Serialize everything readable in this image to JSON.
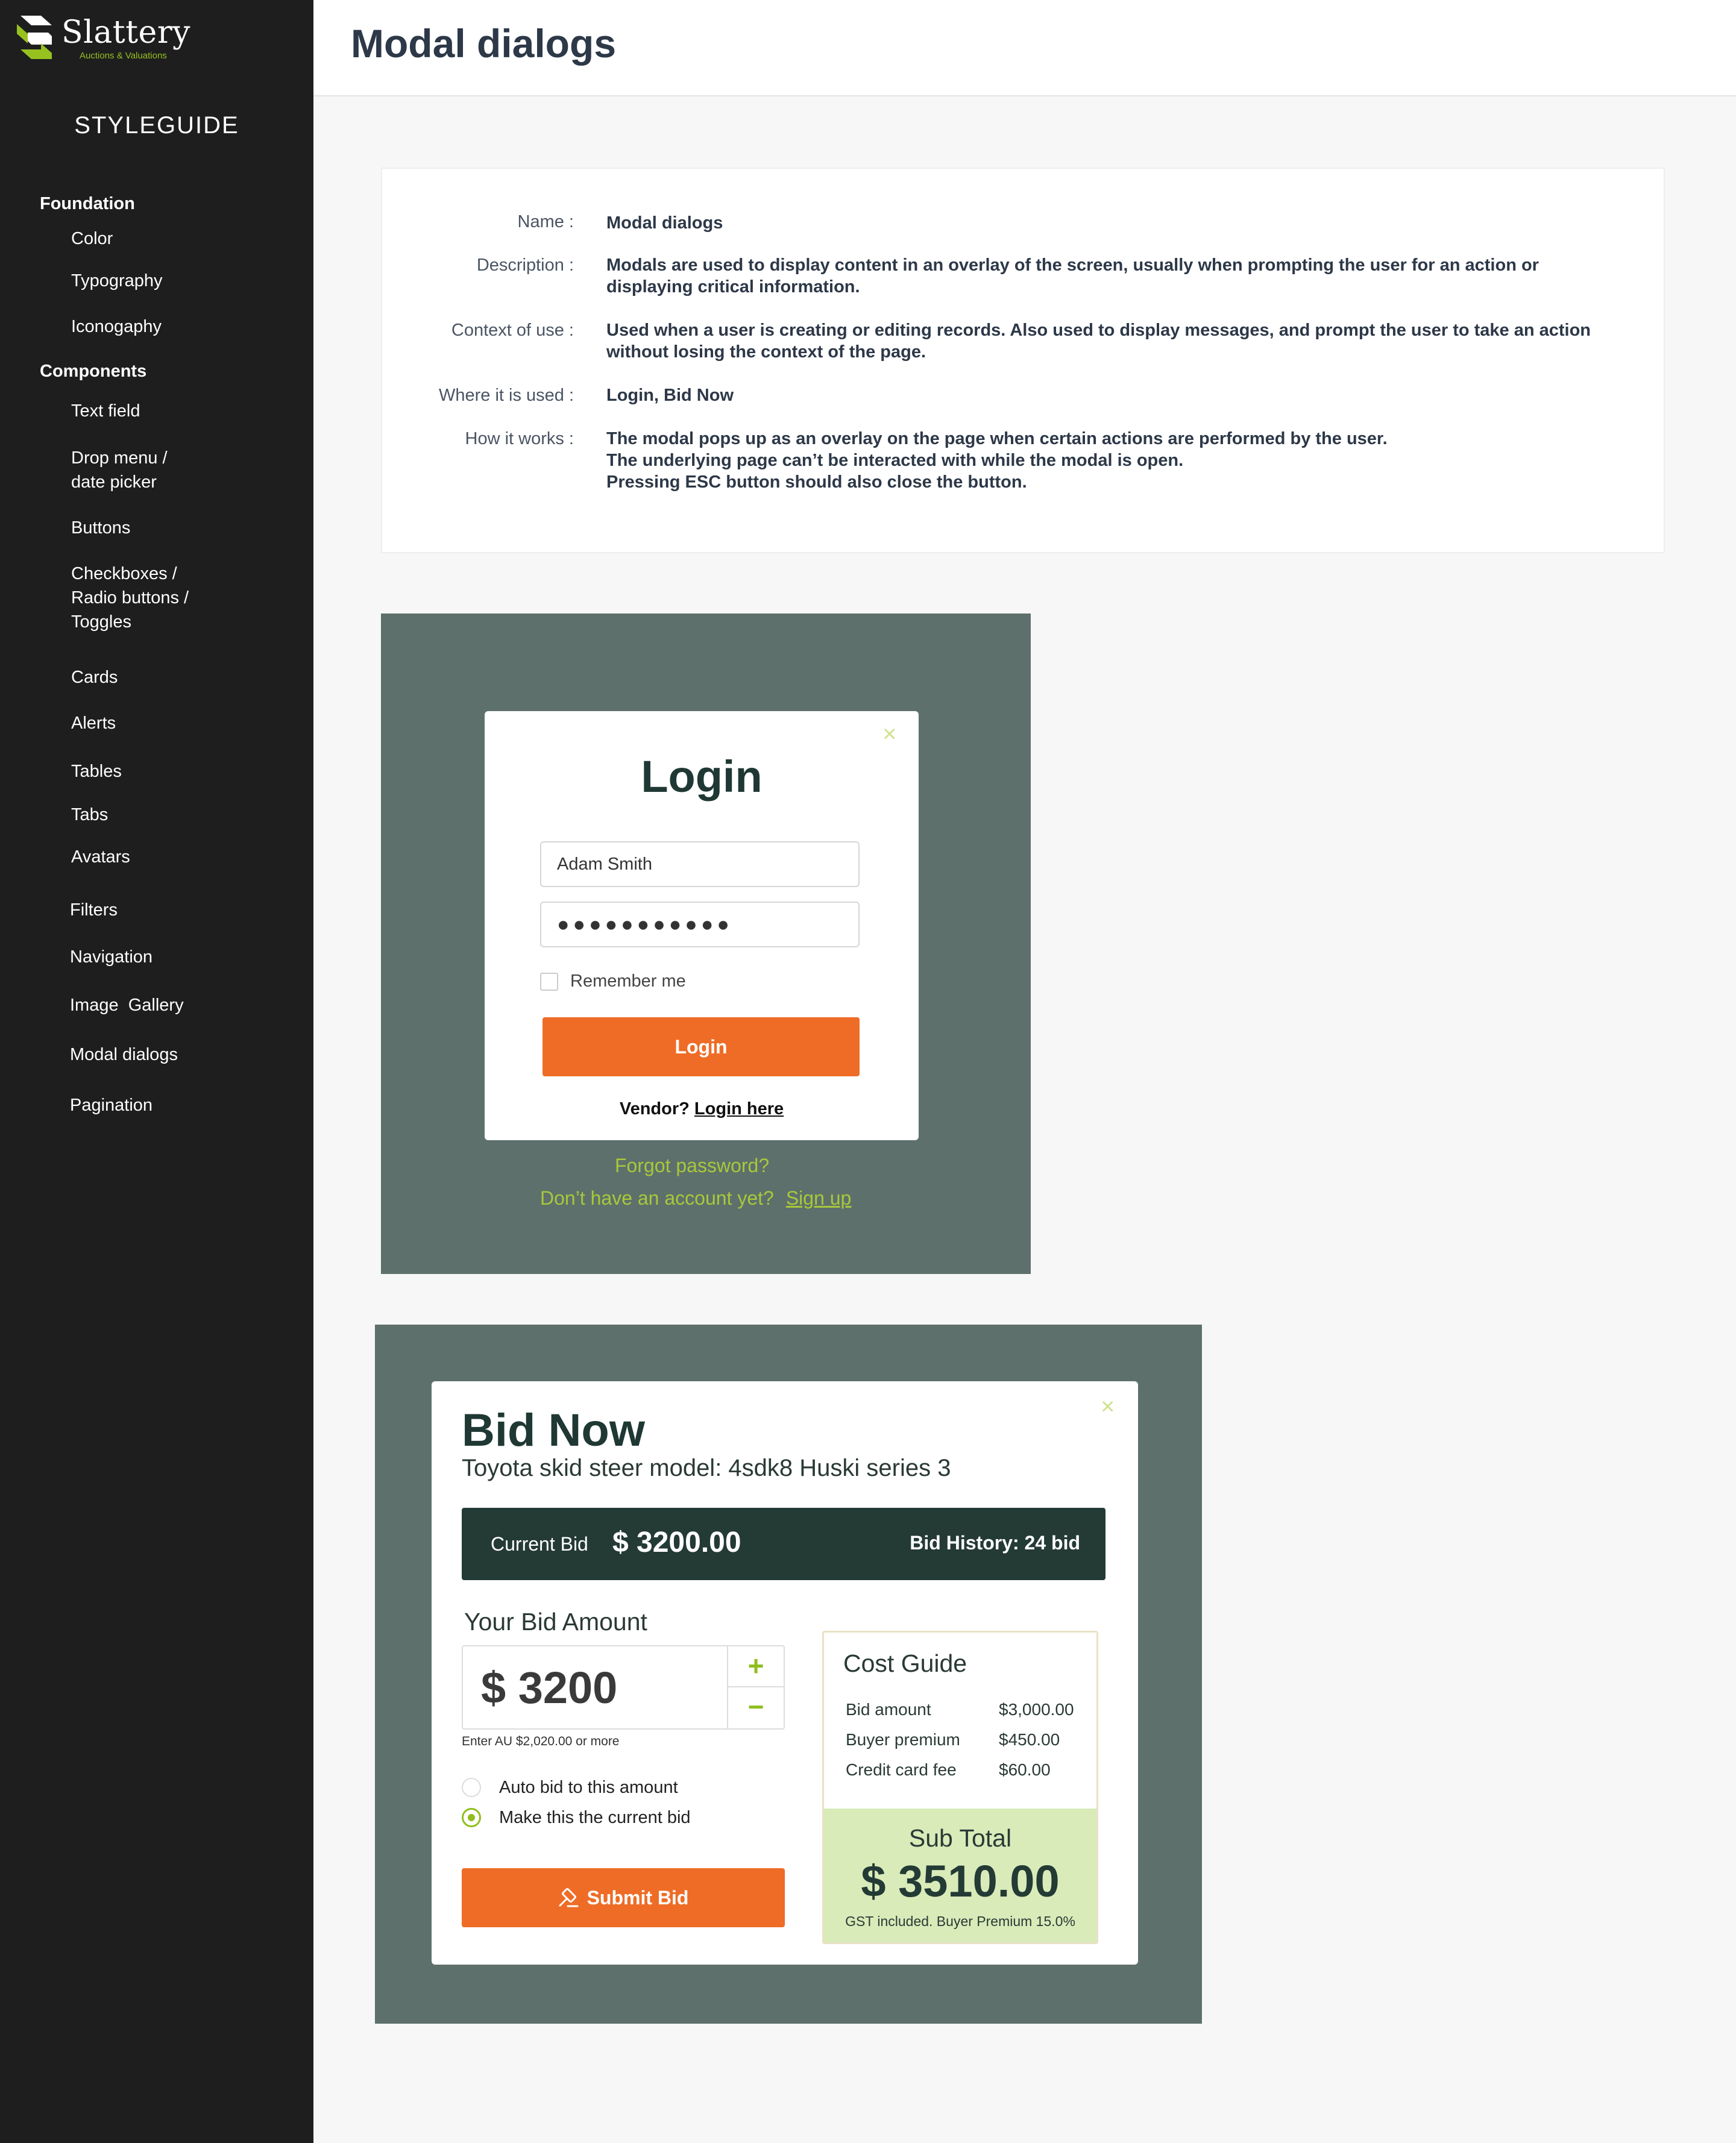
{
  "brand": {
    "name": "Slattery",
    "tagline": "Auctions & Valuations",
    "accent": "#97c11f"
  },
  "sidebar": {
    "heading": "STYLEGUIDE",
    "sections": [
      {
        "title": "Foundation",
        "items": [
          "Color",
          "Typography",
          "Iconogaphy"
        ]
      },
      {
        "title": "Components",
        "items": [
          "Text field",
          "Drop menu /",
          "date picker",
          "Buttons",
          "Checkboxes /",
          "Radio buttons /",
          "Toggles",
          "Cards",
          "Alerts",
          "Tables",
          "Tabs",
          "Avatars",
          "Filters",
          "Navigation",
          "Image  Gallery",
          "Modal dialogs",
          "Pagination"
        ]
      }
    ]
  },
  "header": {
    "title": "Modal dialogs"
  },
  "info": {
    "name_label": "Name :",
    "name_value": "Modal dialogs",
    "description_label": "Description :",
    "description_lines": [
      "Modals are used to display content in an overlay of the screen, usually when prompting the user for an action or",
      "displaying critical information."
    ],
    "context_label": "Context of use  :",
    "context_lines": [
      "Used when a user is creating or editing records. Also used to display messages, and prompt the user to take an action",
      "without losing the context of the page."
    ],
    "where_label": "Where it is used :",
    "where_value": "Login, Bid Now",
    "how_label": "How it works :",
    "how_lines": [
      "The modal pops up as an overlay on the page when certain actions are performed by the user.",
      "The underlying page can’t be interacted with while the modal is open.",
      "Pressing ESC button should also close the button."
    ]
  },
  "login_modal": {
    "title": "Login",
    "close_icon": "close-icon",
    "username_value": "Adam Smith",
    "password_value": "●●●●●●●●●●●",
    "remember_label": "Remember me",
    "remember_checked": false,
    "login_button": "Login",
    "vendor_text": "Vendor?",
    "vendor_link": "Login here",
    "forgot_link": "Forgot password?",
    "no_account_text": "Don’t have an account yet?",
    "signup_link": "Sign up",
    "overlay_color": "#5e706c",
    "button_color": "#ef6c26"
  },
  "bid_modal": {
    "title": "Bid Now",
    "subtitle": "Toyota skid steer model: 4sdk8 Huski series 3",
    "current_bid_label": "Current Bid",
    "current_bid_value": "$ 3200.00",
    "bid_history": "Bid History: 24 bid",
    "your_bid_label": "Your Bid Amount",
    "your_bid_value": "$ 3200",
    "plus_icon": "+",
    "minus_icon": "−",
    "hint": "Enter AU $2,020.00 or more",
    "radio_auto": "Auto bid to this amount",
    "radio_current": "Make this the current bid",
    "selected_option": "Make this the current bid",
    "submit_button": "Submit Bid",
    "submit_icon": "gavel-icon",
    "cost_guide": {
      "title": "Cost Guide",
      "rows": [
        {
          "label": "Bid amount",
          "value": "$3,000.00"
        },
        {
          "label": "Buyer premium",
          "value": "$450.00"
        },
        {
          "label": "Credit card fee",
          "value": "$60.00"
        }
      ],
      "subtotal_label": "Sub Total",
      "subtotal_value": "$ 3510.00",
      "note": "GST included. Buyer Premium 15.0%"
    },
    "bar_color": "#243a35",
    "subtotal_bg": "#d8ebb9"
  }
}
